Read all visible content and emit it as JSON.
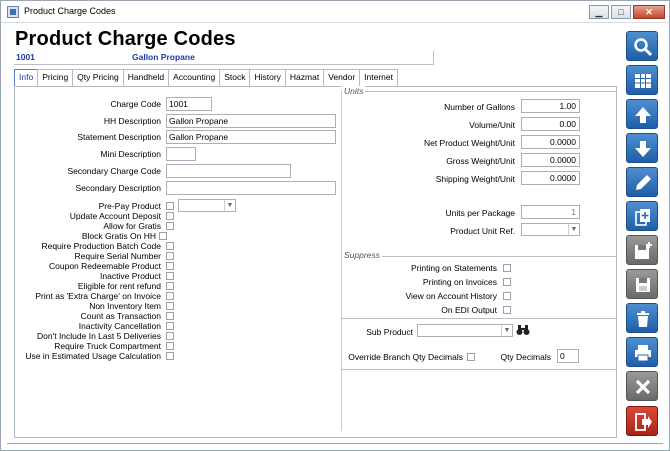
{
  "window": {
    "title": "Product Charge Codes",
    "min_label": "▁",
    "max_label": "□",
    "close_label": "✕"
  },
  "header": {
    "title": "Product Charge Codes",
    "code": "1001",
    "name": "Gallon Propane"
  },
  "tabs": [
    {
      "label": "Info",
      "active": true
    },
    {
      "label": "Pricing"
    },
    {
      "label": "Qty Pricing"
    },
    {
      "label": "Handheld"
    },
    {
      "label": "Accounting"
    },
    {
      "label": "Stock"
    },
    {
      "label": "History"
    },
    {
      "label": "Hazmat"
    },
    {
      "label": "Vendor"
    },
    {
      "label": "Internet"
    }
  ],
  "info": {
    "charge_code_label": "Charge Code",
    "charge_code": "1001",
    "hh_description_label": "HH Description",
    "hh_description": "Gallon Propane",
    "statement_description_label": "Statement Description",
    "statement_description": "Gallon Propane",
    "mini_description_label": "Mini Description",
    "mini_description": "",
    "secondary_charge_code_label": "Secondary Charge Code",
    "secondary_charge_code": "",
    "secondary_description_label": "Secondary Description",
    "secondary_description": ""
  },
  "flags": [
    {
      "label": "Pre-Pay Product",
      "checked": false
    },
    {
      "label": "Update Account Deposit",
      "checked": false
    },
    {
      "label": "Allow for Gratis",
      "checked": false
    },
    {
      "label": "Block Gratis On HH",
      "checked": false
    },
    {
      "label": "Require Production Batch Code",
      "checked": false
    },
    {
      "label": "Require Serial Number",
      "checked": false
    },
    {
      "label": "Coupon Redeemable Product",
      "checked": false
    },
    {
      "label": "Inactive Product",
      "checked": false
    },
    {
      "label": "Eligible for rent refund",
      "checked": false
    },
    {
      "label": "Print as 'Extra Charge' on Invoice",
      "checked": false
    },
    {
      "label": "Non Inventory Item",
      "checked": false
    },
    {
      "label": "Count as Transaction",
      "checked": false
    },
    {
      "label": "Inactivity Cancellation",
      "checked": false
    },
    {
      "label": "Don't Include In Last 5 Deliveries",
      "checked": false
    },
    {
      "label": "Require Truck Compartment",
      "checked": false
    },
    {
      "label": "Use in Estimated Usage Calculation",
      "checked": false
    }
  ],
  "units": {
    "group_title": "Units",
    "number_of_gallons_label": "Number of Gallons",
    "number_of_gallons": "1.00",
    "volume_unit_label": "Volume/Unit",
    "volume_unit": "0.00",
    "net_weight_label": "Net Product Weight/Unit",
    "net_weight": "0.0000",
    "gross_weight_label": "Gross Weight/Unit",
    "gross_weight": "0.0000",
    "shipping_weight_label": "Shipping Weight/Unit",
    "shipping_weight": "0.0000",
    "units_per_package_label": "Units per Package",
    "units_per_package": "1",
    "product_unit_ref_label": "Product Unit Ref.",
    "product_unit_ref": ""
  },
  "suppress": {
    "group_title": "Suppress",
    "items": [
      {
        "label": "Printing on Statements",
        "checked": false
      },
      {
        "label": "Printing on Invoices",
        "checked": false
      },
      {
        "label": "View on Account History",
        "checked": false
      },
      {
        "label": "On EDI Output",
        "checked": false
      }
    ]
  },
  "sub": {
    "sub_product_label": "Sub Product",
    "sub_product": "",
    "override_label": "Override Branch Qty Decimals",
    "qty_decimals_label": "Qty Decimals",
    "qty_decimals": "0"
  },
  "toolbar": [
    {
      "name": "search-icon"
    },
    {
      "name": "grid-icon"
    },
    {
      "name": "arrow-up-icon"
    },
    {
      "name": "arrow-down-icon"
    },
    {
      "name": "pencil-icon"
    },
    {
      "name": "copy-add-icon"
    },
    {
      "name": "save-add-icon"
    },
    {
      "name": "save-icon"
    },
    {
      "name": "trash-icon"
    },
    {
      "name": "print-icon"
    },
    {
      "name": "close-icon"
    },
    {
      "name": "exit-icon"
    }
  ]
}
